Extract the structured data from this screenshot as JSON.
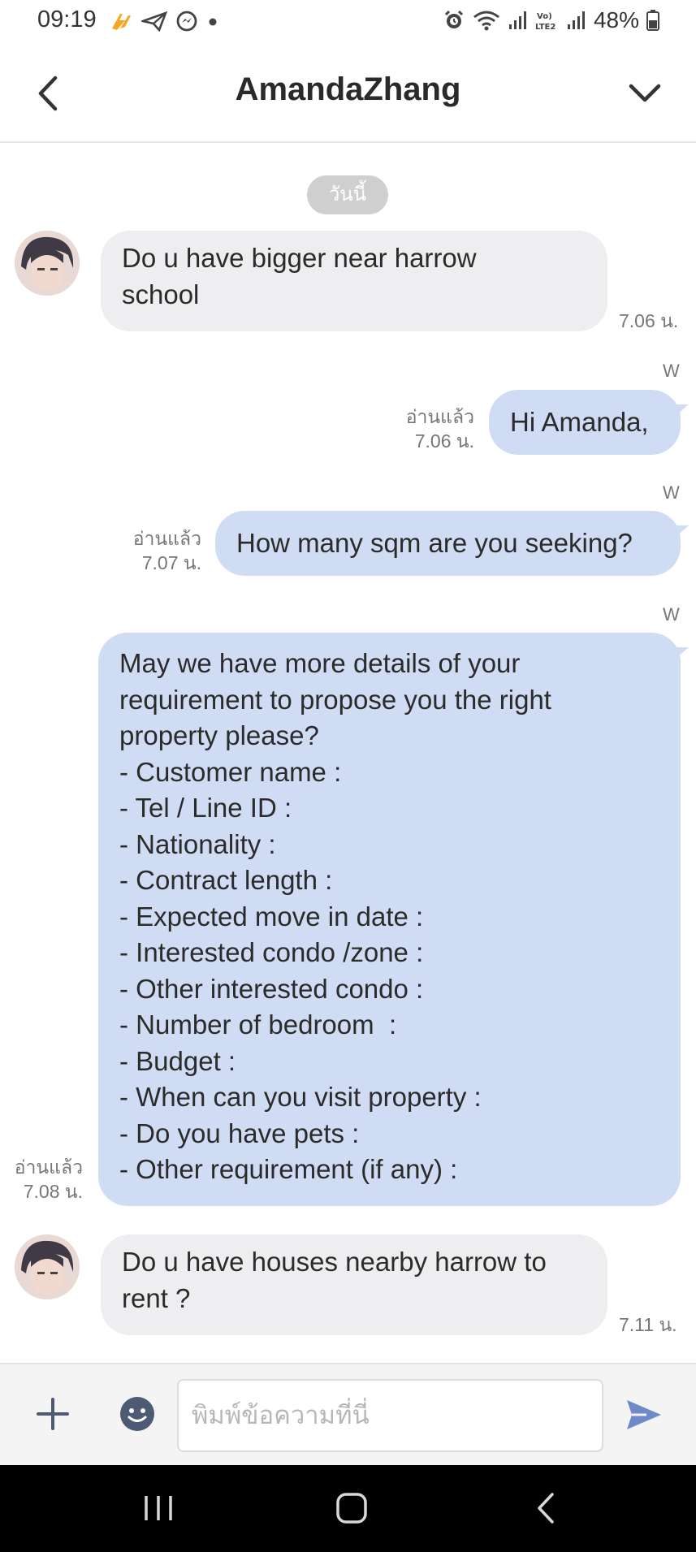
{
  "status_bar": {
    "time": "09:19",
    "battery": "48%",
    "left_icons": [
      "flash-icon",
      "paper-plane-icon",
      "messenger-icon",
      "dot-icon"
    ],
    "right_icons": [
      "alarm-icon",
      "wifi-icon",
      "signal-icon",
      "volte-icon",
      "signal-icon",
      "battery-icon"
    ]
  },
  "header": {
    "title": "AmandaZhang",
    "back_icon": "chevron-left-icon",
    "menu_icon": "chevron-down-icon"
  },
  "chat": {
    "date_label": "วันนี้",
    "messages": [
      {
        "direction": "incoming",
        "text": "Do u have bigger near harrow\nschool",
        "time": "7.06 น."
      },
      {
        "direction": "outgoing",
        "sender_mark": "W",
        "read": "อ่านแล้ว",
        "time": "7.06 น.",
        "text": "Hi Amanda,"
      },
      {
        "direction": "outgoing",
        "sender_mark": "W",
        "read": "อ่านแล้ว",
        "time": "7.07 น.",
        "text": "How many sqm are you seeking?"
      },
      {
        "direction": "outgoing",
        "sender_mark": "W",
        "read": "อ่านแล้ว",
        "time": "7.08 น.",
        "text": "May we have more details of your\nrequirement to propose you the right\nproperty please?\n- Customer name :\n- Tel / Line ID :\n- Nationality :\n- Contract length :\n- Expected move in date :\n- Interested condo /zone :\n- Other interested condo :\n- Number of bedroom  :\n- Budget :\n- When can you visit property :\n- Do you have pets :\n- Other requirement (if any) :"
      },
      {
        "direction": "incoming",
        "text": "Do u have houses nearby harrow to\nrent ?",
        "time": "7.11 น."
      }
    ]
  },
  "input": {
    "placeholder": "พิมพ์ข้อความที่นี่",
    "value": "",
    "plus_icon": "plus-icon",
    "emoji_icon": "emoji-icon",
    "send_icon": "send-icon"
  },
  "nav": {
    "icons": [
      "recent-apps-icon",
      "home-icon",
      "back-icon"
    ]
  },
  "colors": {
    "incoming_bubble": "#eeeef0",
    "outgoing_bubble": "#cfdcf3",
    "date_pill": "#cfcfcf",
    "send_accent": "#7089c8"
  }
}
